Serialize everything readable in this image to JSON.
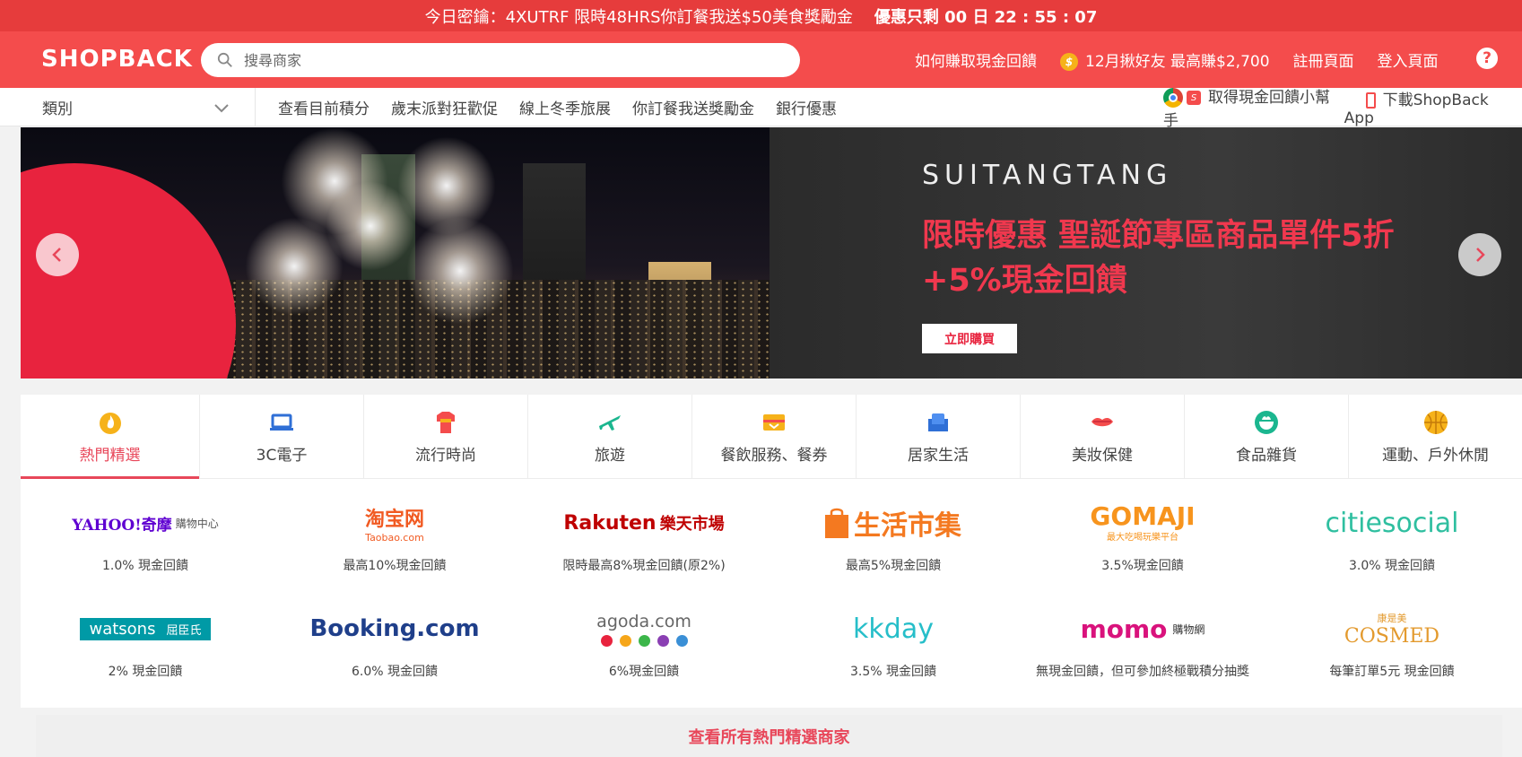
{
  "topbar": {
    "promo": "今日密鑰：4XUTRF 限時48HRS你訂餐我送$50美食獎勵金",
    "countdown": "優惠只剩 00 日 22 : 55 : 07"
  },
  "header": {
    "logo": "SHOPBACK",
    "search_placeholder": "搜尋商家",
    "links": [
      "如何賺取現金回饋",
      "12月揪好友 最高賺$2,700",
      "註冊頁面",
      "登入頁面"
    ],
    "coin_symbol": "$",
    "help": "?"
  },
  "nav": {
    "category_label": "類別",
    "links": [
      "查看目前積分",
      "歲末派對狂歡促",
      "線上冬季旅展",
      "你訂餐我送獎勵金",
      "銀行優惠"
    ],
    "assistant": "取得現金回饋小幫手",
    "assistant_badge": "S",
    "app": "下載ShopBack App"
  },
  "banner": {
    "brand": "SUITANGTANG",
    "headline_line1": "限時優惠 聖誕節專區商品單件5折",
    "headline_line2": "+5%現金回饋",
    "cta": "立即購買"
  },
  "categories": [
    {
      "label": "熱門精選",
      "icon": "flame-icon",
      "color": "#f6b21a",
      "active": true
    },
    {
      "label": "3C電子",
      "icon": "laptop-icon",
      "color": "#2f6fd6",
      "active": false
    },
    {
      "label": "流行時尚",
      "icon": "shirt-icon",
      "color": "#f44c4c",
      "active": false
    },
    {
      "label": "旅遊",
      "icon": "plane-icon",
      "color": "#1bb68f",
      "active": false
    },
    {
      "label": "餐飲服務、餐券",
      "icon": "ticket-icon",
      "color": "#f6b21a",
      "active": false
    },
    {
      "label": "居家生活",
      "icon": "sofa-icon",
      "color": "#2f6fd6",
      "active": false
    },
    {
      "label": "美妝保健",
      "icon": "lips-icon",
      "color": "#f44c4c",
      "active": false
    },
    {
      "label": "食品雜貨",
      "icon": "bowl-icon",
      "color": "#1bb68f",
      "active": false
    },
    {
      "label": "運動、戶外休閒",
      "icon": "basketball-icon",
      "color": "#f6b21a",
      "active": false
    }
  ],
  "merchants": [
    {
      "name": "YAHOO!奇摩",
      "sub": "購物中心",
      "cashback": "1.0% 現金回饋"
    },
    {
      "name": "淘宝网",
      "sub": "Taobao.com",
      "cashback": "最高10%現金回饋"
    },
    {
      "name": "Rakuten",
      "sub": "樂天市場",
      "cashback": "限時最高8%現金回饋(原2%)"
    },
    {
      "name": "生活市集",
      "sub": "",
      "cashback": "最高5%現金回饋"
    },
    {
      "name": "GOMAJI",
      "sub": "最大吃喝玩樂平台",
      "cashback": "3.5%現金回饋"
    },
    {
      "name": "citiesocial",
      "sub": "",
      "cashback": "3.0% 現金回饋"
    },
    {
      "name": "watsons",
      "sub": "屈臣氏",
      "cashback": "2% 現金回饋"
    },
    {
      "name": "Booking.com",
      "sub": "",
      "cashback": "6.0% 現金回饋"
    },
    {
      "name": "agoda.com",
      "sub": "",
      "cashback": "6%現金回饋"
    },
    {
      "name": "kkday",
      "sub": "",
      "cashback": "3.5% 現金回饋"
    },
    {
      "name": "momo",
      "sub": "購物網",
      "cashback": "無現金回饋，但可參加終極戰積分抽獎"
    },
    {
      "name": "COSMED",
      "sub": "康是美",
      "cashback": "每筆訂單5元 現金回饋"
    }
  ],
  "view_all": "查看所有熱門精選商家"
}
